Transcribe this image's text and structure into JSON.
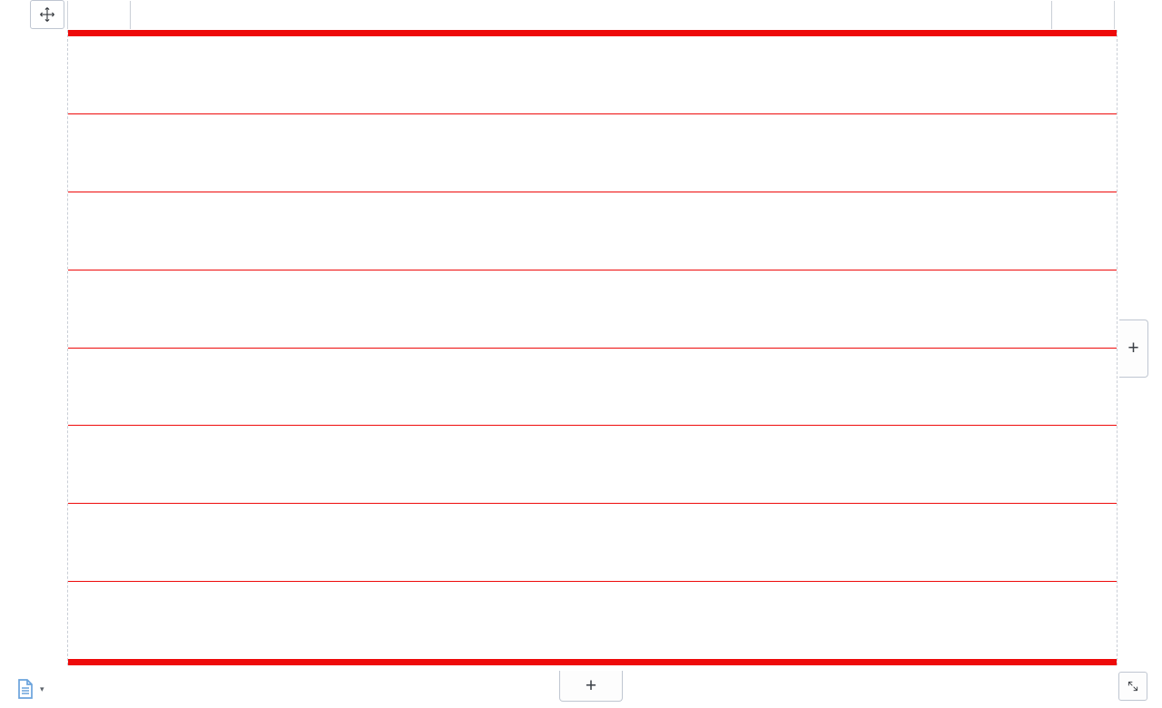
{
  "colors": {
    "selection": "#ee0a0a",
    "chrome_border": "#bfc6d1",
    "page_icon_blue": "#6aa3dc"
  },
  "icons": {
    "move_handle": "move-arrows",
    "add_column": "+",
    "add_row": "+",
    "pages": "document",
    "pages_caret": "▾",
    "resize": "diagonal-arrows"
  },
  "table": {
    "rows": 8,
    "columns": 1,
    "cells": [
      [
        ""
      ],
      [
        ""
      ],
      [
        ""
      ],
      [
        ""
      ],
      [
        ""
      ],
      [
        ""
      ],
      [
        ""
      ],
      [
        ""
      ]
    ]
  },
  "buttons": {
    "add_column_label": "+",
    "add_row_label": "+"
  }
}
